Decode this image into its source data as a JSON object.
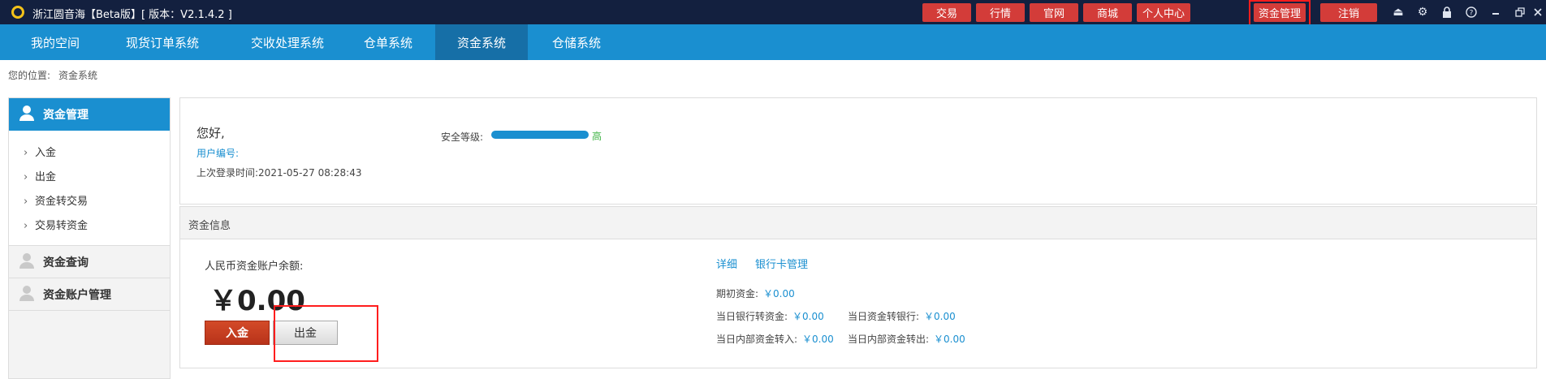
{
  "titlebar": {
    "title": "浙江圆音海【Beta版】[ 版本：V2.1.4.2 ]",
    "buttons": [
      "交易",
      "行情",
      "官网",
      "商城",
      "个人中心",
      "资金管理",
      "注销"
    ],
    "icons": [
      "eject-icon",
      "gear-icon",
      "lock-icon",
      "help-icon",
      "minimize-icon",
      "restore-icon",
      "close-icon"
    ]
  },
  "nav": {
    "items": [
      "我的空间",
      "现货订单系统",
      "交收处理系统",
      "仓单系统",
      "资金系统",
      "仓储系统"
    ],
    "active": "资金系统"
  },
  "breadcrumb": {
    "label": "您的位置:",
    "current": "资金系统"
  },
  "sidebar": {
    "sections": [
      {
        "title": "资金管理",
        "items": [
          "入金",
          "出金",
          "资金转交易",
          "交易转资金"
        ]
      },
      {
        "title": "资金查询"
      },
      {
        "title": "资金账户管理"
      }
    ]
  },
  "profile": {
    "greeting": "您好,",
    "user_id_label": "用户编号:",
    "last_login_label": "上次登录时间:",
    "last_login_value": "2021-05-27 08:28:43",
    "security_label": "安全等级:",
    "security_level": "高",
    "security_fill_fraction": 1.0
  },
  "funds": {
    "header": "资金信息",
    "balance_label": "人民币资金账户余额:",
    "balance_amount": "￥0.00",
    "deposit_button": "入金",
    "withdraw_button": "出金",
    "links": [
      "详细",
      "银行卡管理"
    ],
    "details": {
      "opening_label": "期初资金:",
      "opening_value": "￥0.00",
      "bank_to_fund_label": "当日银行转资金:",
      "bank_to_fund_value": "￥0.00",
      "fund_to_bank_label": "当日资金转银行:",
      "fund_to_bank_value": "￥0.00",
      "internal_in_label": "当日内部资金转入:",
      "internal_in_value": "￥0.00",
      "internal_out_label": "当日内部资金转出:",
      "internal_out_value": "￥0.00"
    }
  },
  "colors": {
    "titlebar_bg": "#13203f",
    "nav_bg": "#1a8fd0",
    "nav_active": "#166fa7",
    "topbtn_bg": "#d33c39",
    "highlight": "#ff1d1d",
    "deposit_btn": "#c63e20",
    "link": "#1a8fd0",
    "security_high": "#3fb345"
  }
}
